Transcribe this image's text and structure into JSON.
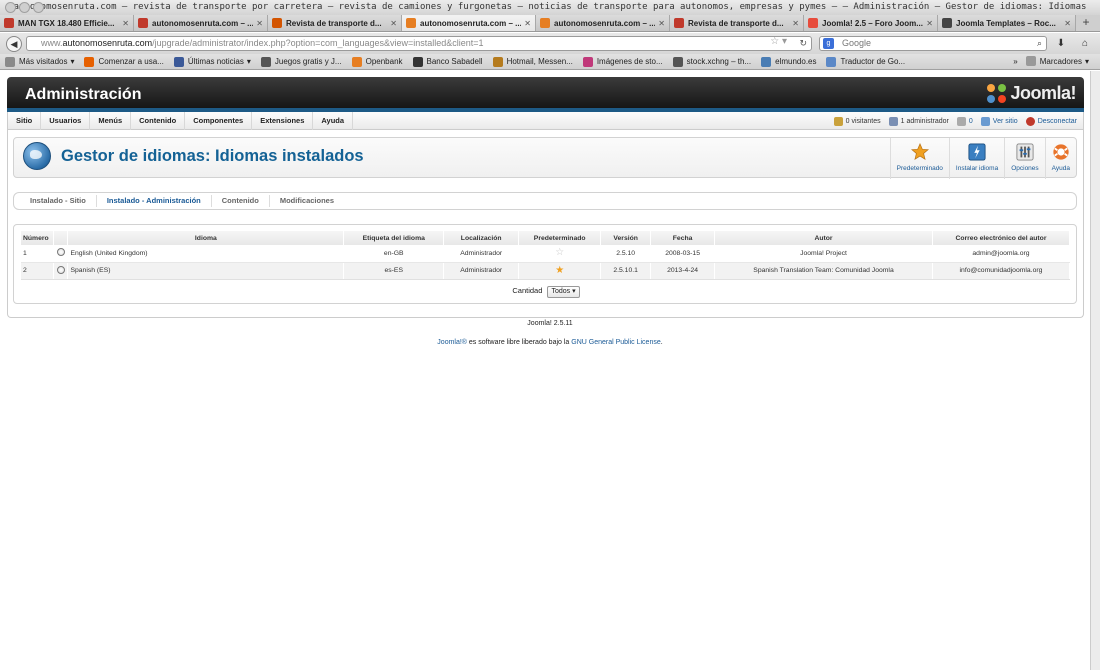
{
  "browser": {
    "window_title": "autonomosenruta.com – revista de transporte por carretera – revista de camiones y furgonetas – noticias de transporte para autonomos, empresas y pymes – – Administración – Gestor de idiomas: Idiomas instalados",
    "tabs": [
      {
        "label": "MAN TGX 18.480 Efficie...",
        "icon_color": "#c0392b",
        "active": false
      },
      {
        "label": "autonomosenruta.com – ...",
        "icon_color": "#c0392b",
        "active": false
      },
      {
        "label": "Revista de transporte d...",
        "icon_color": "#d35400",
        "active": false
      },
      {
        "label": "autonomosenruta.com – ...",
        "icon_color": "#e67e22",
        "active": true
      },
      {
        "label": "autonomosenruta.com – ...",
        "icon_color": "#e67e22",
        "active": false
      },
      {
        "label": "Revista de transporte d...",
        "icon_color": "#c0392b",
        "active": false
      },
      {
        "label": "Joomla! 2.5 – Foro Joom...",
        "icon_color": "#e74c3c",
        "active": false
      },
      {
        "label": "Joomla Templates – Roc...",
        "icon_color": "#444444",
        "active": false
      }
    ],
    "url_prefix": "www.",
    "url_host": "autonomosenruta.com",
    "url_path": "/jupgrade/administrator/index.php?option=com_languages&view=installed&client=1",
    "search_placeholder": "Google",
    "bookmarks": [
      {
        "label": "Más visitados",
        "dropdown": true
      },
      {
        "label": "Comenzar a usa...",
        "dropdown": false
      },
      {
        "label": "Últimas noticias",
        "dropdown": true
      },
      {
        "label": "Juegos gratis y J...",
        "dropdown": false
      },
      {
        "label": "Openbank",
        "dropdown": false
      },
      {
        "label": "Banco Sabadell",
        "dropdown": false
      },
      {
        "label": "Hotmail, Messen...",
        "dropdown": false
      },
      {
        "label": "Imágenes de sto...",
        "dropdown": false
      },
      {
        "label": "stock.xchng – th...",
        "dropdown": false
      },
      {
        "label": "elmundo.es",
        "dropdown": false
      },
      {
        "label": "Traductor de Go...",
        "dropdown": false
      }
    ],
    "bookmarks_menu": "Marcadores"
  },
  "admin": {
    "title": "Administración",
    "logo_text": "Joomla!",
    "menu": [
      "Sitio",
      "Usuarios",
      "Menús",
      "Contenido",
      "Componentes",
      "Extensiones",
      "Ayuda"
    ],
    "status": {
      "visitors": "0 visitantes",
      "admins": "1 administrador",
      "messages": "0",
      "view_site": "Ver sitio",
      "logout": "Desconectar"
    }
  },
  "page": {
    "title": "Gestor de idiomas: Idiomas instalados",
    "toolbar": [
      {
        "label": "Predeterminado",
        "icon": "star-icon"
      },
      {
        "label": "Instalar idioma",
        "icon": "install-icon"
      },
      {
        "label": "Opciones",
        "icon": "options-icon"
      },
      {
        "label": "Ayuda",
        "icon": "help-icon"
      }
    ],
    "subnav": [
      {
        "label": "Instalado - Sitio",
        "active": false
      },
      {
        "label": "Instalado - Administración",
        "active": true
      },
      {
        "label": "Contenido",
        "active": false
      },
      {
        "label": "Modificaciones",
        "active": false
      }
    ],
    "table": {
      "headers": [
        "Número",
        "",
        "Idioma",
        "Etiqueta del idioma",
        "Localización",
        "Predeterminado",
        "Versión",
        "Fecha",
        "Autor",
        "Correo electrónico del autor"
      ],
      "rows": [
        {
          "num": "1",
          "language": "English (United Kingdom)",
          "tag": "en-GB",
          "location": "Administrador",
          "default": false,
          "version": "2.5.10",
          "date": "2008-03-15",
          "author": "Joomla! Project",
          "email": "admin@joomla.org"
        },
        {
          "num": "2",
          "language": "Spanish (ES)",
          "tag": "es-ES",
          "location": "Administrador",
          "default": true,
          "version": "2.5.10.1",
          "date": "2013-4-24",
          "author": "Spanish Translation Team: Comunidad Joomla",
          "email": "info@comunidadjoomla.org"
        }
      ]
    },
    "pagination_label": "Cantidad",
    "pagination_value": "Todos"
  },
  "footer": {
    "version": "Joomla! 2.5.11",
    "link1": "Joomla!®",
    "text": " es software libre liberado bajo la ",
    "link2": "GNU General Public License",
    "period": "."
  }
}
